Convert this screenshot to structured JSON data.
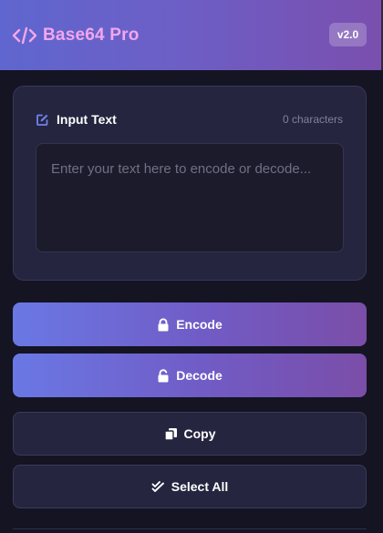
{
  "header": {
    "title": "Base64 Pro",
    "version": "v2.0",
    "icon": "code-icon"
  },
  "input_card": {
    "title": "Input Text",
    "title_icon": "edit-icon",
    "char_count": "0 characters",
    "textarea_value": "",
    "textarea_placeholder": "Enter your text here to encode or decode..."
  },
  "actions": {
    "encode_label": "Encode",
    "decode_label": "Decode",
    "copy_label": "Copy",
    "select_all_label": "Select All"
  },
  "colors": {
    "header_title": "#f3a6ee",
    "accent_start": "#6a78e4",
    "accent_end": "#7a4ea8",
    "background": "#141423",
    "card": "#25253f"
  }
}
